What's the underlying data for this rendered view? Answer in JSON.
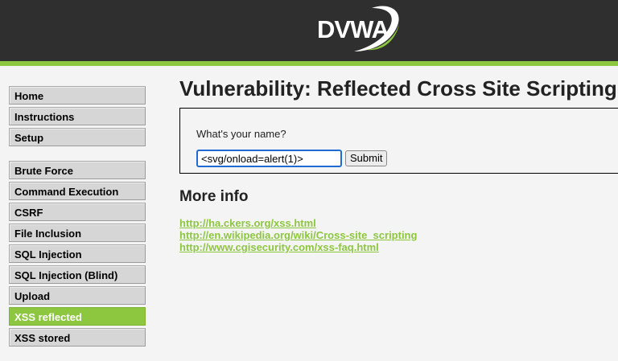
{
  "header": {
    "logo_text": "DVWA"
  },
  "menu": {
    "groups": [
      {
        "items": [
          {
            "label": "Home"
          },
          {
            "label": "Instructions"
          },
          {
            "label": "Setup"
          }
        ]
      },
      {
        "items": [
          {
            "label": "Brute Force"
          },
          {
            "label": "Command Execution"
          },
          {
            "label": "CSRF"
          },
          {
            "label": "File Inclusion"
          },
          {
            "label": "SQL Injection"
          },
          {
            "label": "SQL Injection (Blind)"
          },
          {
            "label": "Upload"
          },
          {
            "label": "XSS reflected",
            "selected": true
          },
          {
            "label": "XSS stored"
          }
        ]
      }
    ]
  },
  "main": {
    "title": "Vulnerability: Reflected Cross Site Scripting",
    "form": {
      "label": "What's your name?",
      "input_value": "<svg/onload=alert(1)>",
      "submit_label": "Submit"
    },
    "more_info": {
      "title": "More info",
      "links": [
        "http://ha.ckers.org/xss.html",
        "http://en.wikipedia.org/wiki/Cross-site_scripting",
        "http://www.cgisecurity.com/xss-faq.html"
      ]
    }
  },
  "colors": {
    "accent_green": "#8dc63f",
    "header_dark": "#2f2f2f",
    "focus_blue": "#1e6bd6"
  }
}
